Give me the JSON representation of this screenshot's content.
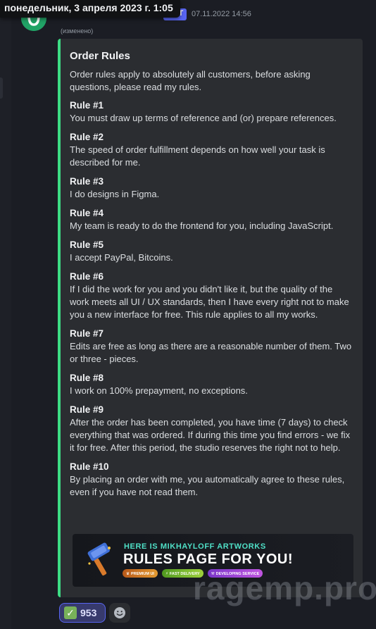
{
  "tooltip": {
    "datetime": "понедельник, 3 апреля 2023 г. 1:05"
  },
  "message": {
    "bot_tag": "БОТ",
    "timestamp": "07.11.2022 14:56",
    "edited": "(изменено)"
  },
  "embed": {
    "accent_color": "#3ddc84",
    "title": "Order Rules",
    "description": "Order rules apply to absolutely all customers, before asking questions, please read my rules.",
    "rules": [
      {
        "name": "Rule #1",
        "text": "You must draw up terms of reference and (or) prepare references."
      },
      {
        "name": "Rule #2",
        "text": "The speed of order fulfillment depends on how well your task is described for me."
      },
      {
        "name": "Rule #3",
        "text": "I do designs in Figma."
      },
      {
        "name": "Rule #4",
        "text": "My team is ready to do the frontend for you, including JavaScript."
      },
      {
        "name": "Rule #5",
        "text": "I accept PayPal, Bitcoins."
      },
      {
        "name": "Rule #6",
        "text": "If I did the work for you and you didn't like it, but the quality of the work meets all UI / UX standards, then I have every right not to make you a new interface for free. This rule applies to all my works."
      },
      {
        "name": "Rule #7",
        "text": "Edits are free as long as there are a reasonable number of them. Two or three - pieces."
      },
      {
        "name": "Rule #8",
        "text": "I work on 100% prepayment, no exceptions."
      },
      {
        "name": "Rule #9",
        "text": "After the order has been completed, you have time (7 days) to check everything that was ordered. If during this time you find errors - we fix it for free. After this period, the studio reserves the right not to help."
      },
      {
        "name": "Rule #10",
        "text": "By placing an order with me, you automatically agree to these rules, even if you have not read them."
      }
    ],
    "banner": {
      "top_text": "HERE IS MIKHAYLOFF ARTWORKS",
      "big_text": "RULES PAGE FOR YOU!",
      "chips": [
        "PREMIUM UI",
        "FAST DELIVERY",
        "DEVELOPING SERVICE"
      ]
    }
  },
  "reactions": [
    {
      "emoji": "white-check-mark-icon",
      "count": "953"
    }
  ],
  "add_reaction_icon": "smiley-icon",
  "watermark": "ragemp.pro"
}
